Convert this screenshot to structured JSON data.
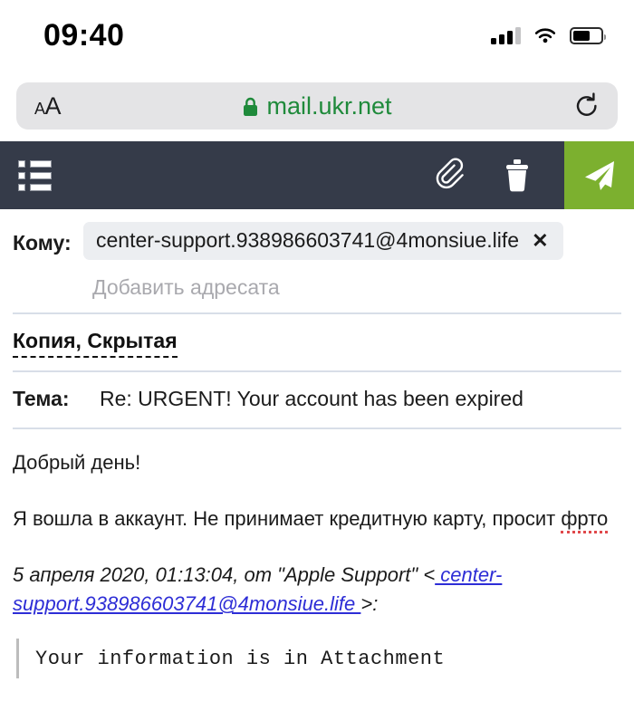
{
  "status_bar": {
    "time": "09:40",
    "signal_icon": "cellular-signal-icon",
    "wifi_icon": "wifi-icon",
    "battery_icon": "battery-icon",
    "battery_level": 62
  },
  "browser": {
    "text_size_button": "AA",
    "lock_icon": "lock-icon",
    "url": "mail.ukr.net",
    "reload_icon": "reload-icon",
    "url_color": "#1f8a3b"
  },
  "toolbar": {
    "menu_icon": "list-menu-icon",
    "attach_icon": "paperclip-icon",
    "delete_icon": "trash-icon",
    "send_icon": "send-paper-plane-icon",
    "send_color": "#7cb02f",
    "bar_color": "#353b49"
  },
  "compose": {
    "to_label": "Кому:",
    "recipient_chip": "center-support.938986603741@4monsiue.life",
    "chip_remove": "✕",
    "add_recipient_placeholder": "Добавить адресата",
    "cc_bcc_label": "Копия, Скрытая",
    "subject_label": "Тема:",
    "subject_value": "Re: URGENT! Your account has been expired"
  },
  "message": {
    "greeting": "Добрый день!",
    "paragraph_before": "Я вошла в аккаунт. Не принимает кредитную карту, просит ",
    "misspelled_word": "фрто",
    "quote_prefix": "5 апреля 2020, 01:13:04, от \"Apple Support\" <",
    "quote_link": " center-support.938986603741@4monsiue.life ",
    "quote_suffix": ">:",
    "quoted_body": "Your information is in Attachment"
  }
}
